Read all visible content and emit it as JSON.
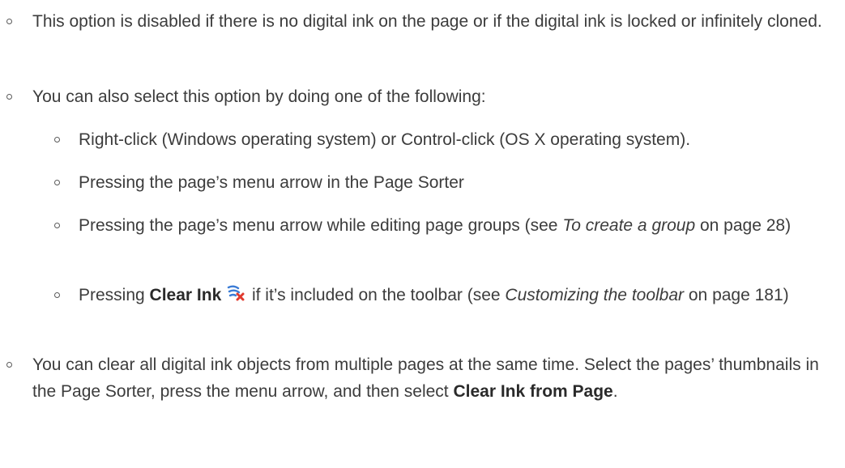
{
  "notes": {
    "note1": "This option is disabled if there is no digital ink on the page or if the digital ink is locked or infinitely cloned.",
    "note2": "You can also select this option by doing one of the following:",
    "sub1": "Right-click (Windows operating system) or Control-click (OS X operating system).",
    "sub2": "Pressing the page’s menu arrow in the Page Sorter",
    "sub3": {
      "pre": "Pressing the page’s menu arrow while editing page groups (see ",
      "link": "To create a group",
      "post": " on page 28)"
    },
    "sub4": {
      "pre": "Pressing ",
      "bold": "Clear Ink",
      "icon": "clear-ink-icon",
      "mid": " if it’s included on the toolbar (see ",
      "link": "Customizing the toolbar",
      "post": " on page 181)"
    },
    "note3": {
      "pre": "You can clear all digital ink objects from multiple pages at the same time. Select the pages’ thumbnails in the Page Sorter, press the menu arrow, and then select ",
      "bold": "Clear Ink from Page",
      "post": "."
    }
  },
  "colors": {
    "text": "#3c3c3c",
    "bullet": "#5a5a5a",
    "icon_blue": "#3a7bd5",
    "icon_red": "#e03a2e"
  }
}
